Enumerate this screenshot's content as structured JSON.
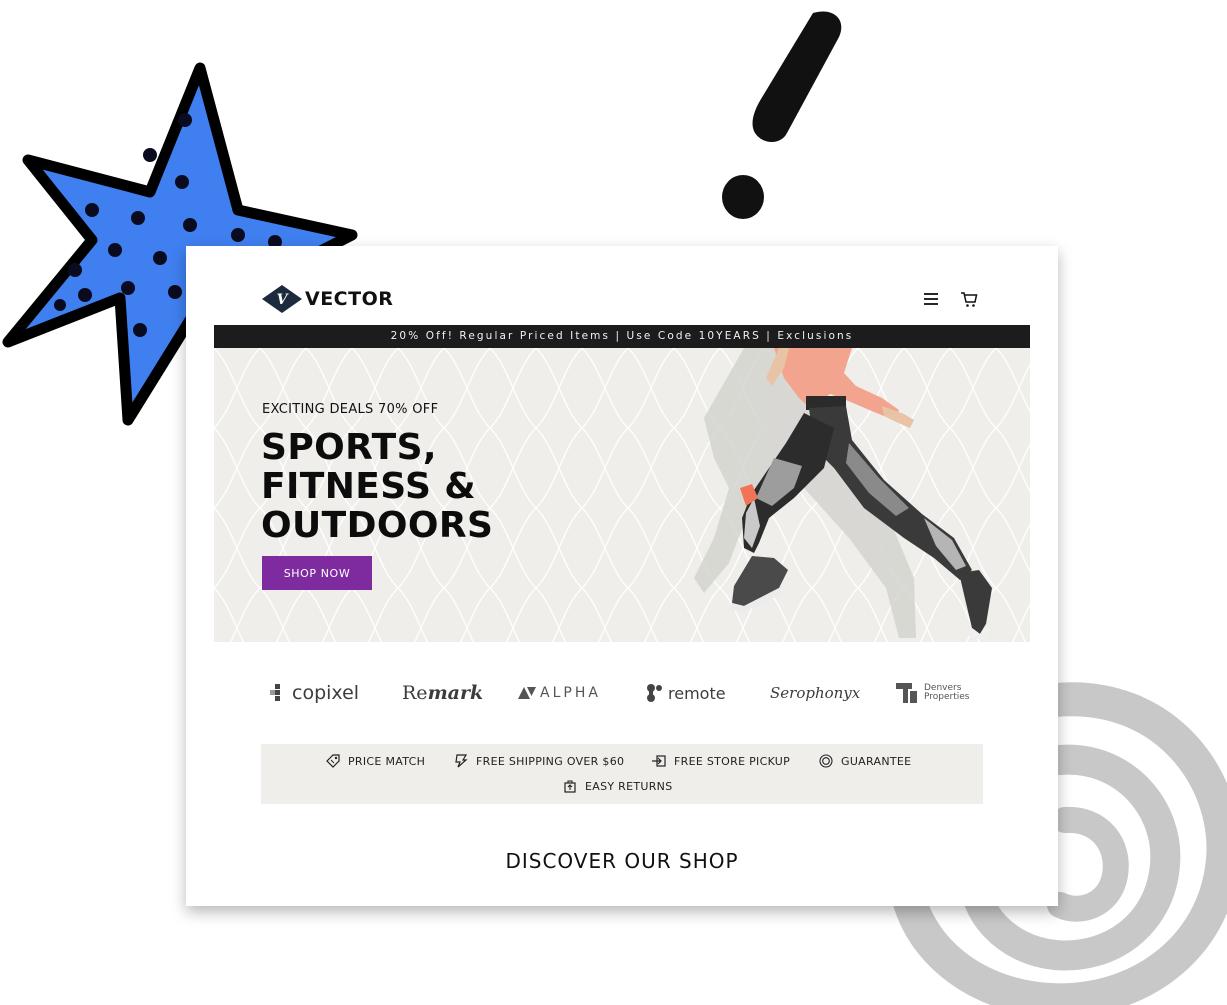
{
  "brand": {
    "name": "VECTOR",
    "logo_letter": "V"
  },
  "header": {
    "menu_icon": "hamburger-menu-icon",
    "cart_icon": "shopping-cart-icon"
  },
  "promo_bar": {
    "text": "20% Off! Regular Priced Items | Use Code 10YEARS | Exclusions"
  },
  "hero": {
    "kicker": "EXCITING DEALS 70% OFF",
    "title_lines": [
      "SPORTS,",
      "FITNESS &",
      "OUTDOORS"
    ],
    "cta_label": "SHOP NOW",
    "colors": {
      "background": "#efeeea",
      "cta": "#7f2ba0"
    }
  },
  "partner_logos": [
    {
      "name": "copixel"
    },
    {
      "name": "Remark",
      "parts": [
        "Re",
        "mark"
      ]
    },
    {
      "name": "ALPHA"
    },
    {
      "name": "remote"
    },
    {
      "name": "Serophonyx"
    },
    {
      "name": "Denvers Properties",
      "lines": [
        "Denvers",
        "Properties"
      ]
    }
  ],
  "features": [
    {
      "label": "PRICE MATCH",
      "icon": "price-tag-icon"
    },
    {
      "label": "FREE SHIPPING OVER $60",
      "icon": "shipping-icon"
    },
    {
      "label": "FREE STORE PICKUP",
      "icon": "store-pickup-icon"
    },
    {
      "label": "GUARANTEE",
      "icon": "guarantee-icon"
    },
    {
      "label": "EASY RETURNS",
      "icon": "returns-icon"
    }
  ],
  "sections": {
    "discover_title": "DISCOVER OUR SHOP"
  },
  "decorations": {
    "star_color": "#3f7ff0",
    "exclamation_color": "#111111",
    "spiral_color": "#c8c8c8"
  }
}
